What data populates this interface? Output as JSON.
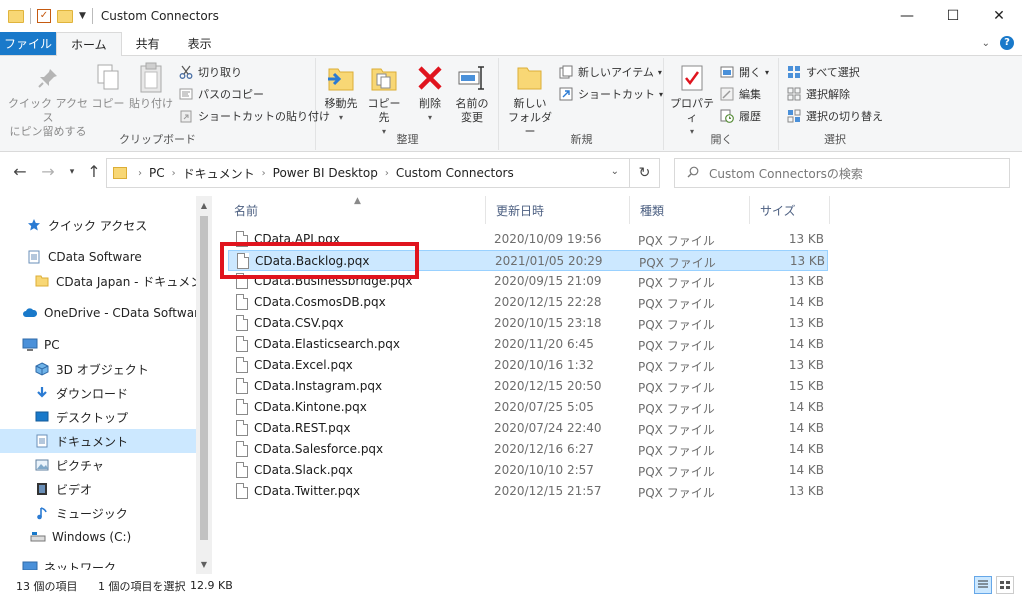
{
  "window": {
    "title": "Custom Connectors",
    "minimize": "—",
    "maximize": "☐",
    "close": "✕"
  },
  "ribbon_tabs": [
    "ファイル",
    "ホーム",
    "共有",
    "表示"
  ],
  "ribbon": {
    "clipboard": {
      "label": "クリップボード",
      "pin": [
        "クイック アクセス",
        "にピン留めする"
      ],
      "copy": "コピー",
      "paste": "貼り付け",
      "cut": "切り取り",
      "copy_path": "パスのコピー",
      "paste_shortcut": "ショートカットの貼り付け"
    },
    "organize": {
      "label": "整理",
      "move_to": "移動先",
      "copy_to": "コピー先",
      "delete": "削除",
      "rename": [
        "名前の",
        "変更"
      ]
    },
    "new": {
      "label": "新規",
      "new_folder": [
        "新しい",
        "フォルダー"
      ],
      "new_item": "新しいアイテム",
      "shortcut": "ショートカット"
    },
    "open": {
      "label": "開く",
      "properties": "プロパティ",
      "open": "開く",
      "edit": "編集",
      "history": "履歴"
    },
    "select": {
      "label": "選択",
      "select_all": "すべて選択",
      "select_none": "選択解除",
      "invert": "選択の切り替え"
    }
  },
  "address": {
    "crumbs": [
      "PC",
      "ドキュメント",
      "Power BI Desktop",
      "Custom Connectors"
    ],
    "search_placeholder": "Custom Connectorsの検索"
  },
  "nav": [
    {
      "label": "クイック アクセス",
      "icon": "star-icon"
    },
    {
      "label": "CData Software",
      "icon": "document-icon"
    },
    {
      "label": "CData Japan - ドキュメント",
      "icon": "folder-icon"
    },
    {
      "label": "OneDrive - CData Software",
      "icon": "cloud-icon"
    },
    {
      "label": "PC",
      "icon": "computer-icon"
    },
    {
      "label": "3D オブジェクト",
      "icon": "cube-icon"
    },
    {
      "label": "ダウンロード",
      "icon": "download-icon"
    },
    {
      "label": "デスクトップ",
      "icon": "desktop-icon"
    },
    {
      "label": "ドキュメント",
      "icon": "document-icon"
    },
    {
      "label": "ピクチャ",
      "icon": "picture-icon"
    },
    {
      "label": "ビデオ",
      "icon": "video-icon"
    },
    {
      "label": "ミュージック",
      "icon": "music-icon"
    },
    {
      "label": "Windows (C:)",
      "icon": "drive-icon"
    },
    {
      "label": "ネットワーク",
      "icon": "network-icon"
    }
  ],
  "columns": [
    "名前",
    "更新日時",
    "種類",
    "サイズ"
  ],
  "files": [
    {
      "name": "CData.API.pqx",
      "date": "2020/10/09 19:56",
      "type": "PQX ファイル",
      "size": "13 KB"
    },
    {
      "name": "CData.Backlog.pqx",
      "date": "2021/01/05 20:29",
      "type": "PQX ファイル",
      "size": "13 KB"
    },
    {
      "name": "CData.Businessbridge.pqx",
      "date": "2020/09/15 21:09",
      "type": "PQX ファイル",
      "size": "13 KB"
    },
    {
      "name": "CData.CosmosDB.pqx",
      "date": "2020/12/15 22:28",
      "type": "PQX ファイル",
      "size": "14 KB"
    },
    {
      "name": "CData.CSV.pqx",
      "date": "2020/10/15 23:18",
      "type": "PQX ファイル",
      "size": "13 KB"
    },
    {
      "name": "CData.Elasticsearch.pqx",
      "date": "2020/11/20 6:45",
      "type": "PQX ファイル",
      "size": "14 KB"
    },
    {
      "name": "CData.Excel.pqx",
      "date": "2020/10/16 1:32",
      "type": "PQX ファイル",
      "size": "13 KB"
    },
    {
      "name": "CData.Instagram.pqx",
      "date": "2020/12/15 20:50",
      "type": "PQX ファイル",
      "size": "15 KB"
    },
    {
      "name": "CData.Kintone.pqx",
      "date": "2020/07/25 5:05",
      "type": "PQX ファイル",
      "size": "14 KB"
    },
    {
      "name": "CData.REST.pqx",
      "date": "2020/07/24 22:40",
      "type": "PQX ファイル",
      "size": "14 KB"
    },
    {
      "name": "CData.Salesforce.pqx",
      "date": "2020/12/16 6:27",
      "type": "PQX ファイル",
      "size": "14 KB"
    },
    {
      "name": "CData.Slack.pqx",
      "date": "2020/10/10 2:57",
      "type": "PQX ファイル",
      "size": "14 KB"
    },
    {
      "name": "CData.Twitter.pqx",
      "date": "2020/12/15 21:57",
      "type": "PQX ファイル",
      "size": "13 KB"
    }
  ],
  "selected_file": "CData.Backlog.pqx",
  "status": {
    "count": "13 個の項目",
    "selection": "1 個の項目を選択",
    "size": "12.9 KB"
  },
  "colors": {
    "accent": "#1979ca",
    "selection": "#cce8ff",
    "highlight_box": "#e0141e"
  }
}
